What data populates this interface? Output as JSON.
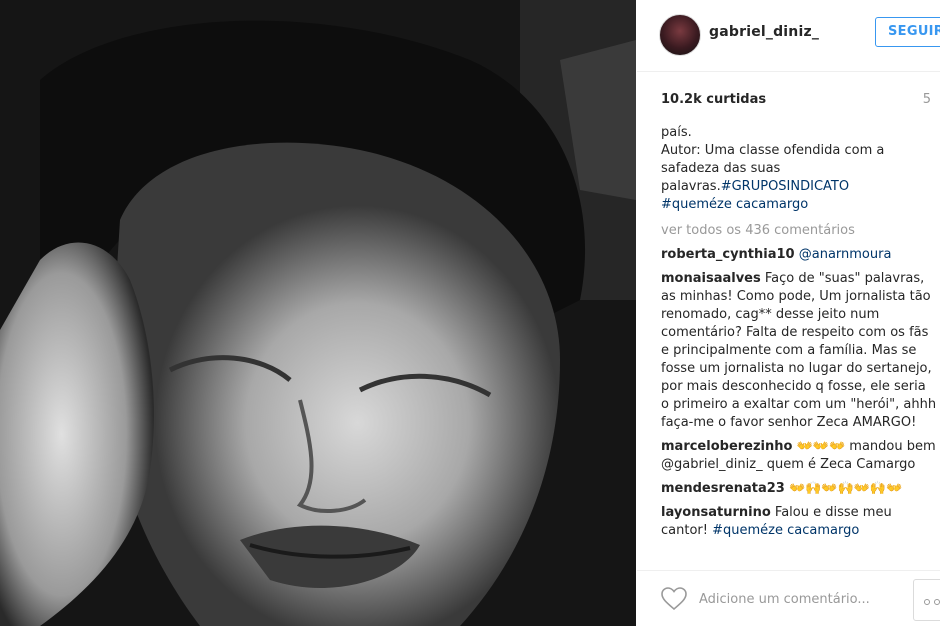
{
  "post": {
    "image_alt": "gabriel_diniz_"
  },
  "header": {
    "username": "gabriel_diniz_",
    "follow_label": "SEGUIR"
  },
  "stats": {
    "likes": "10.2k curtidas",
    "time": "5"
  },
  "caption": {
    "line1": "país.",
    "line2": "Autor: Uma classe ofendida com a",
    "line3": "safadeza das suas",
    "line4_text": "palavras.",
    "tag1": "#GRUPOSINDICATO",
    "tag2": "#queméze cacamargo"
  },
  "view_all": "ver todos os 436 comentários",
  "comments": [
    {
      "user": "roberta_cynthia10",
      "text": "@anarnmoura"
    },
    {
      "user": "monaisaalves",
      "text": "Faço de \"suas\" palavras, as minhas! Como pode, Um jornalista tão renomado, cag** desse jeito num comentário? Falta de respeito com os fãs e principalmente com a família. Mas se fosse um jornalista no lugar do sertanejo, por mais desconhecido q fosse, ele seria o primeiro a exaltar com um \"herói\", ahhh faça-me o favor senhor Zeca AMARGO!"
    },
    {
      "user": "marceloberezinho",
      "text": "👐👐👐 mandou bem @gabriel_diniz_ quem é Zeca Camargo"
    },
    {
      "user": "mendesrenata23",
      "text": "👐🙌👐🙌👐🙌👐"
    },
    {
      "user": "layonsaturnino",
      "text": "Falou e disse meu cantor!",
      "tag": "#queméze cacamargo"
    }
  ],
  "footer": {
    "placeholder": "Adicione um comentário..."
  },
  "colors": {
    "link": "#003569",
    "accent": "#3897f0",
    "muted": "#999999"
  }
}
